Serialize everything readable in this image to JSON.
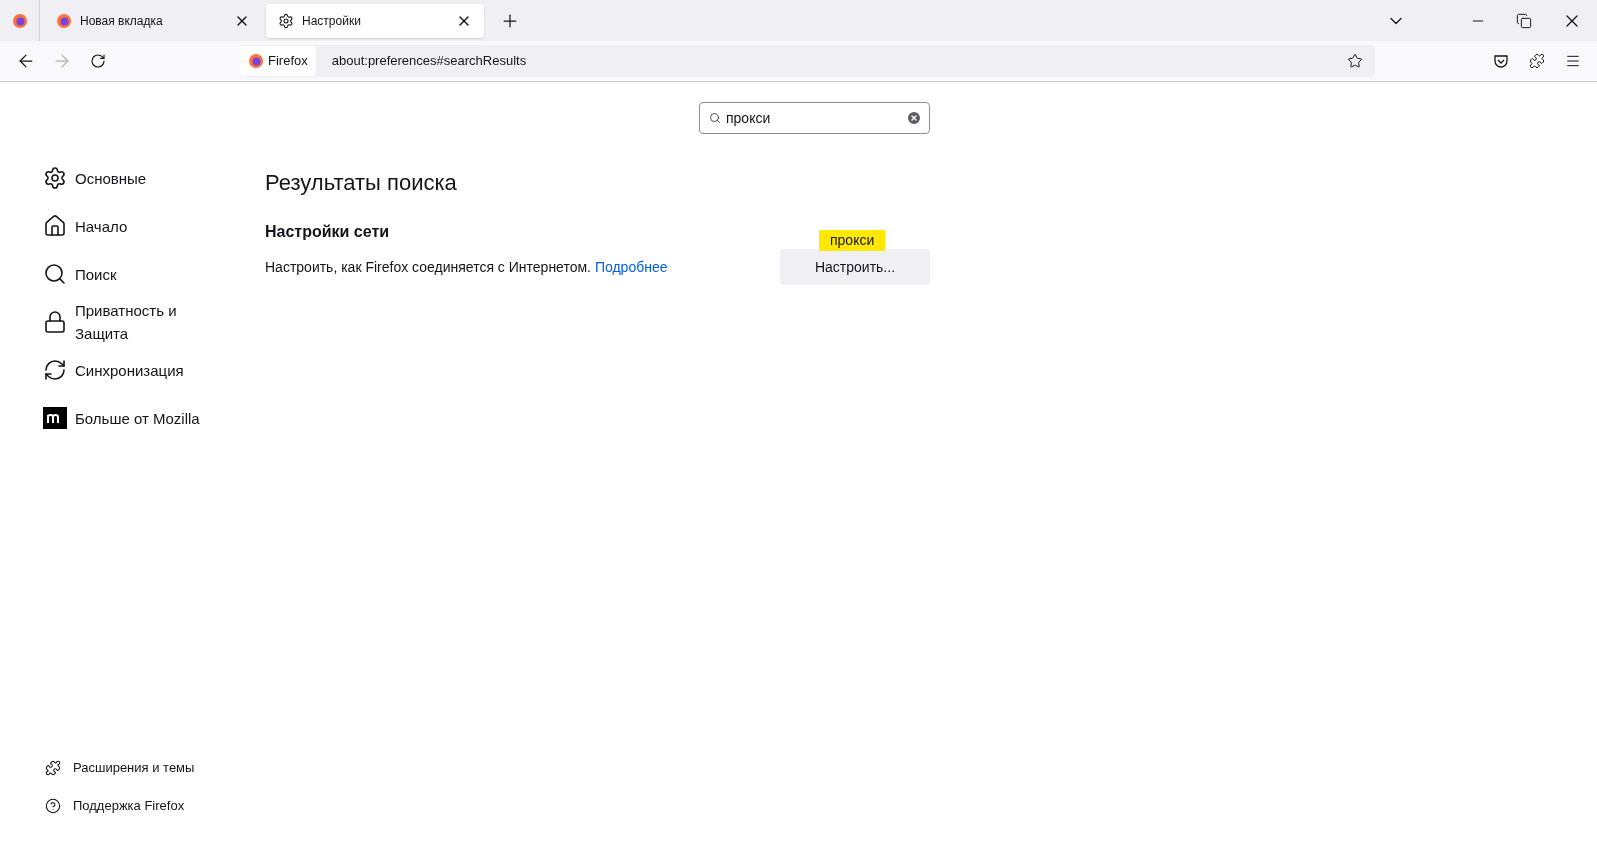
{
  "tabs": [
    {
      "kind": "firefox",
      "label": "Новая вкладка",
      "selected": false
    },
    {
      "kind": "gear",
      "label": "Настройки",
      "selected": true
    }
  ],
  "address_bar": {
    "identity": "Firefox",
    "url": "about:preferences#searchResults"
  },
  "search": {
    "value": "прокси"
  },
  "sidebar": {
    "items": [
      {
        "kind": "gear",
        "label": "Основные"
      },
      {
        "kind": "home",
        "label": "Начало"
      },
      {
        "kind": "search",
        "label": "Поиск"
      },
      {
        "kind": "lock",
        "label": "Приватность и Защита"
      },
      {
        "kind": "sync",
        "label": "Синхронизация"
      },
      {
        "kind": "mozilla",
        "label": "Больше от Mozilla"
      }
    ],
    "footer": [
      {
        "kind": "puzzle",
        "label": "Расширения и темы"
      },
      {
        "kind": "help",
        "label": "Поддержка Firefox"
      }
    ]
  },
  "results": {
    "title": "Результаты поиска",
    "section_title": "Настройки сети",
    "description": "Настроить, как Firefox соединяется с Интернетом.",
    "link": "Подробнее",
    "button": "Настроить...",
    "highlight": "прокси"
  }
}
